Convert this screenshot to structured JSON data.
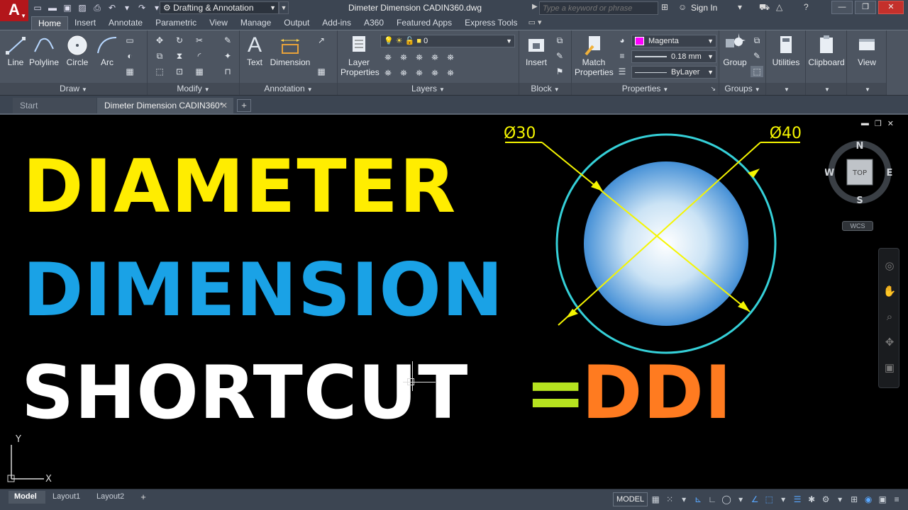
{
  "titlebar": {
    "app_logo": "A",
    "workspace": "Drafting & Annotation",
    "document_title": "Dimeter Dimension CADIN360.dwg",
    "search_placeholder": "Type a keyword or phrase",
    "sign_in": "Sign In"
  },
  "ribbon_tabs": [
    "Home",
    "Insert",
    "Annotate",
    "Parametric",
    "View",
    "Manage",
    "Output",
    "Add-ins",
    "A360",
    "Featured Apps",
    "Express Tools"
  ],
  "ribbon": {
    "draw": {
      "title": "Draw",
      "line": "Line",
      "polyline": "Polyline",
      "circle": "Circle",
      "arc": "Arc"
    },
    "modify": {
      "title": "Modify"
    },
    "annotation": {
      "title": "Annotation",
      "text": "Text",
      "dimension": "Dimension"
    },
    "layers": {
      "title": "Layers",
      "layer_properties_1": "Layer",
      "layer_properties_2": "Properties",
      "current_layer": "0"
    },
    "block": {
      "title": "Block",
      "insert": "Insert"
    },
    "properties": {
      "title": "Properties",
      "match_1": "Match",
      "match_2": "Properties",
      "color": "Magenta",
      "lineweight": "0.18 mm",
      "linetype": "ByLayer"
    },
    "groups": {
      "title": "Groups",
      "group": "Group"
    },
    "utilities": "Utilities",
    "clipboard": "Clipboard",
    "view": "View"
  },
  "file_tabs": {
    "start": "Start",
    "document": "Dimeter Dimension CADIN360*"
  },
  "canvas": {
    "line1": "DIAMETER",
    "line2": "DIMENSION",
    "line3": "SHORTCUT",
    "equals": "=",
    "shortcut": "DDI",
    "dim_small": "Ø30",
    "dim_large": "Ø40",
    "viewcube": {
      "n": "N",
      "s": "S",
      "e": "E",
      "w": "W",
      "top": "TOP"
    },
    "wcs": "WCS",
    "ucs": {
      "x": "X",
      "y": "Y"
    }
  },
  "layout_tabs": [
    "Model",
    "Layout1",
    "Layout2"
  ],
  "status": {
    "model": "MODEL"
  },
  "colors": {
    "yellow": "#ffed00",
    "blue": "#1aa2e6",
    "green": "#b6e31f",
    "orange": "#ff7b20",
    "cyan_circle": "#35d0d8",
    "dim_yellow": "#f5f500"
  }
}
